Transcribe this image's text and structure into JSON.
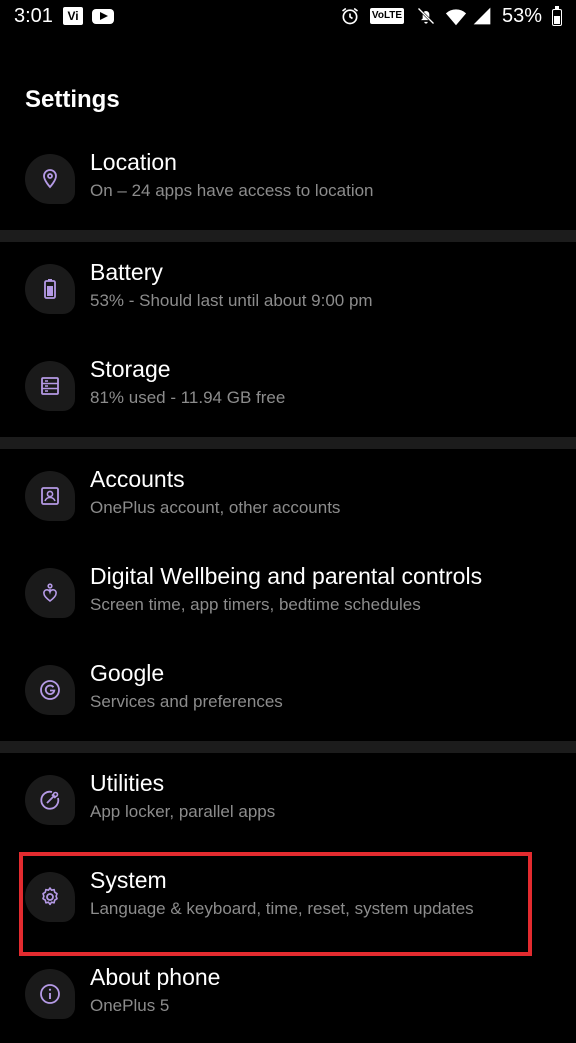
{
  "status_bar": {
    "time": "3:01",
    "carrier_badge": "Vi",
    "volte_badge": "VoLTE",
    "battery_percent": "53%",
    "battery_level": 0.53,
    "icons": [
      "carrier-icon",
      "youtube-icon",
      "alarm-icon",
      "volte-icon",
      "mute-icon",
      "wifi-icon",
      "signal-icon",
      "battery-icon"
    ]
  },
  "header": {
    "title": "Settings"
  },
  "colors": {
    "background": "#000000",
    "divider": "#1c1c1c",
    "icon_bg": "#1a1a1a",
    "accent": "#b59ae6",
    "subtitle": "#8c8c8c",
    "highlight": "#e32b2f"
  },
  "items": [
    {
      "title": "Location",
      "subtitle": "On – 24 apps have access to location",
      "icon": "location-pin-icon"
    },
    {
      "title": "Battery",
      "subtitle": "53% - Should last until about 9:00 pm",
      "icon": "battery-icon"
    },
    {
      "title": "Storage",
      "subtitle": "81% used - 11.94 GB free",
      "icon": "storage-icon"
    },
    {
      "title": "Accounts",
      "subtitle": "OnePlus account, other accounts",
      "icon": "account-icon"
    },
    {
      "title": "Digital Wellbeing and parental controls",
      "subtitle": "Screen time, app timers, bedtime schedules",
      "icon": "wellbeing-icon"
    },
    {
      "title": "Google",
      "subtitle": "Services and preferences",
      "icon": "google-icon"
    },
    {
      "title": "Utilities",
      "subtitle": "App locker, parallel apps",
      "icon": "utilities-icon"
    },
    {
      "title": "System",
      "subtitle": "Language & keyboard, time, reset, system updates",
      "icon": "gear-icon"
    },
    {
      "title": "About phone",
      "subtitle": "OnePlus 5",
      "icon": "info-icon"
    }
  ],
  "highlighted_item": "System"
}
